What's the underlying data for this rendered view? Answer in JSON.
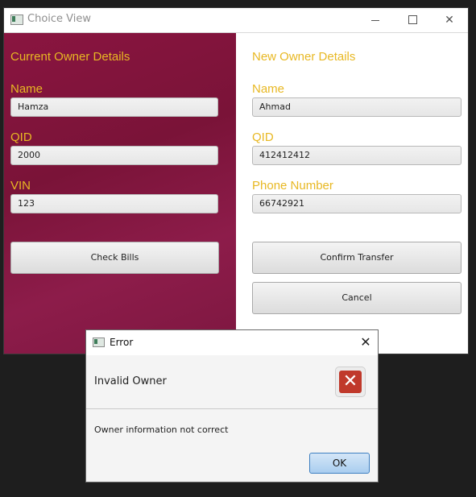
{
  "window": {
    "title": "Choice View",
    "controls": {
      "minimize": "minimize",
      "maximize": "maximize",
      "close": "✕"
    }
  },
  "current_owner": {
    "heading": "Current Owner Details",
    "name_label": "Name",
    "name_value": "Hamza",
    "qid_label": "QID",
    "qid_value": "2000",
    "vin_label": "VIN",
    "vin_value": "123",
    "check_bills_label": "Check Bills"
  },
  "new_owner": {
    "heading": "New Owner Details",
    "name_label": "Name",
    "name_value": "Ahmad",
    "qid_label": "QID",
    "qid_value": "412412412",
    "phone_label": "Phone Number",
    "phone_value": "66742921",
    "confirm_label": "Confirm Transfer",
    "cancel_label": "Cancel"
  },
  "dialog": {
    "title": "Error",
    "close": "✕",
    "header": "Invalid Owner",
    "icon": "error-x-icon",
    "error_symbol": "✕",
    "content": "Owner information not correct",
    "ok_label": "OK"
  },
  "colors": {
    "panel_bg": "#7e1640",
    "label_gold": "#e8b823",
    "error_red": "#c0392b"
  }
}
